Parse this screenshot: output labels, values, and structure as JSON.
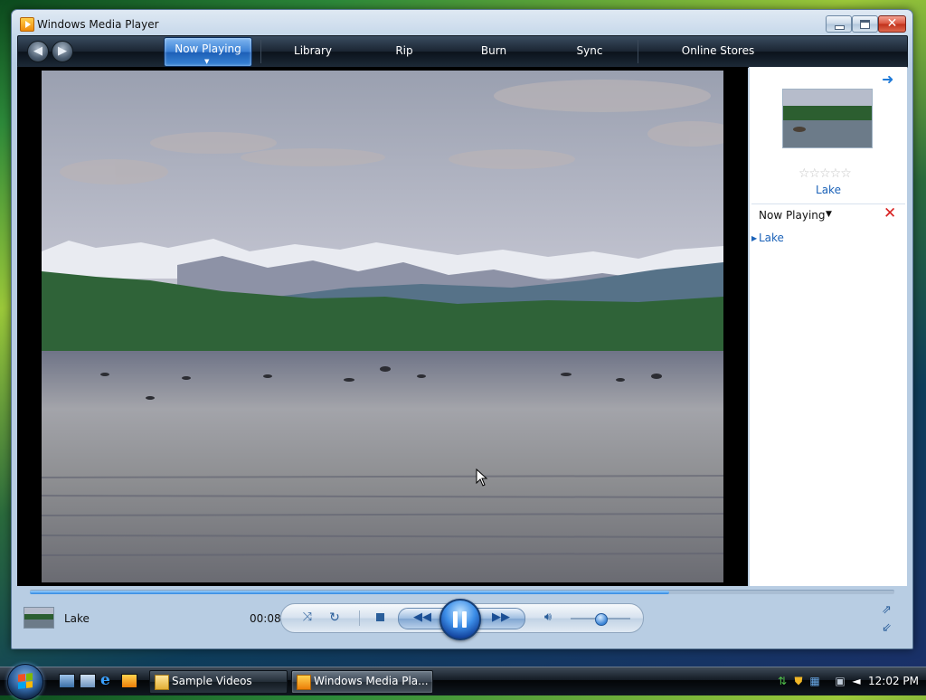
{
  "window": {
    "title": "Windows Media Player"
  },
  "nav": {
    "back_icon": "back-arrow-icon",
    "forward_icon": "forward-arrow-icon",
    "tabs": [
      {
        "label": "Now Playing",
        "active": true
      },
      {
        "label": "Library"
      },
      {
        "label": "Rip"
      },
      {
        "label": "Burn"
      },
      {
        "label": "Sync"
      },
      {
        "label": "Online Stores"
      }
    ]
  },
  "side_pane": {
    "current_title": "Lake",
    "rating_stars": "☆☆☆☆☆",
    "rating": 0,
    "list_header": "Now Playing",
    "list_dropdown_glyph": "▼",
    "clear_glyph": "✕",
    "playlist": [
      {
        "label": "Lake"
      }
    ]
  },
  "player": {
    "title": "Lake",
    "elapsed": "00:08",
    "seek_progress": 0.74,
    "volume_level": 0.5,
    "accent": "#2d86e0"
  },
  "taskbar": {
    "buttons": [
      {
        "label": "Sample Videos",
        "icon": "folder-icon"
      },
      {
        "label": "Windows Media Pla...",
        "icon": "wmp-icon",
        "active": true
      }
    ],
    "clock": "12:02 PM"
  }
}
